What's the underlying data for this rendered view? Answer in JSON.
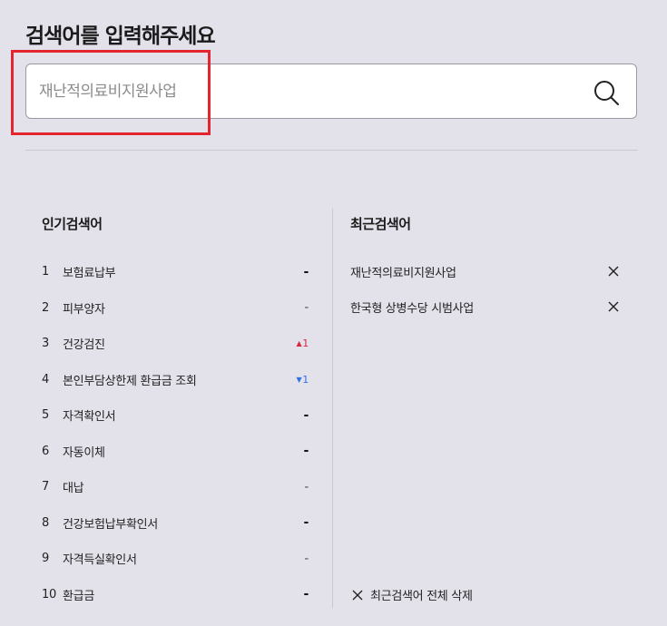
{
  "header": {
    "title": "검색어를 입력해주세요"
  },
  "search": {
    "value": "",
    "placeholder": "재난적의료비지원사업",
    "button_icon": "search-icon"
  },
  "popular": {
    "title": "인기검색어",
    "items": [
      {
        "rank": "1",
        "keyword": "보험료납부",
        "trend": "-",
        "trend_type": "same"
      },
      {
        "rank": "2",
        "keyword": "피부양자",
        "trend": "-",
        "trend_type": "same-light"
      },
      {
        "rank": "3",
        "keyword": "건강검진",
        "trend": "1",
        "trend_type": "up",
        "trend_icon": "▲"
      },
      {
        "rank": "4",
        "keyword": "본인부담상한제 환급금 조회",
        "trend": "1",
        "trend_type": "down",
        "trend_icon": "▼"
      },
      {
        "rank": "5",
        "keyword": "자격확인서",
        "trend": "-",
        "trend_type": "same"
      },
      {
        "rank": "6",
        "keyword": "자동이체",
        "trend": "-",
        "trend_type": "same"
      },
      {
        "rank": "7",
        "keyword": "대납",
        "trend": "-",
        "trend_type": "same-light"
      },
      {
        "rank": "8",
        "keyword": "건강보험납부확인서",
        "trend": "-",
        "trend_type": "same"
      },
      {
        "rank": "9",
        "keyword": "자격득실확인서",
        "trend": "-",
        "trend_type": "same-light"
      },
      {
        "rank": "10",
        "keyword": "환급금",
        "trend": "-",
        "trend_type": "same"
      }
    ]
  },
  "recent": {
    "title": "최근검색어",
    "items": [
      {
        "keyword": "재난적의료비지원사업"
      },
      {
        "keyword": "한국형 상병수당 시범사업"
      }
    ],
    "clear_all_label": "최근검색어 전체 삭제"
  },
  "colors": {
    "background": "#e3e1ea",
    "highlight": "#e3252f",
    "trend_up": "#d7263d",
    "trend_down": "#2f6fe0"
  }
}
